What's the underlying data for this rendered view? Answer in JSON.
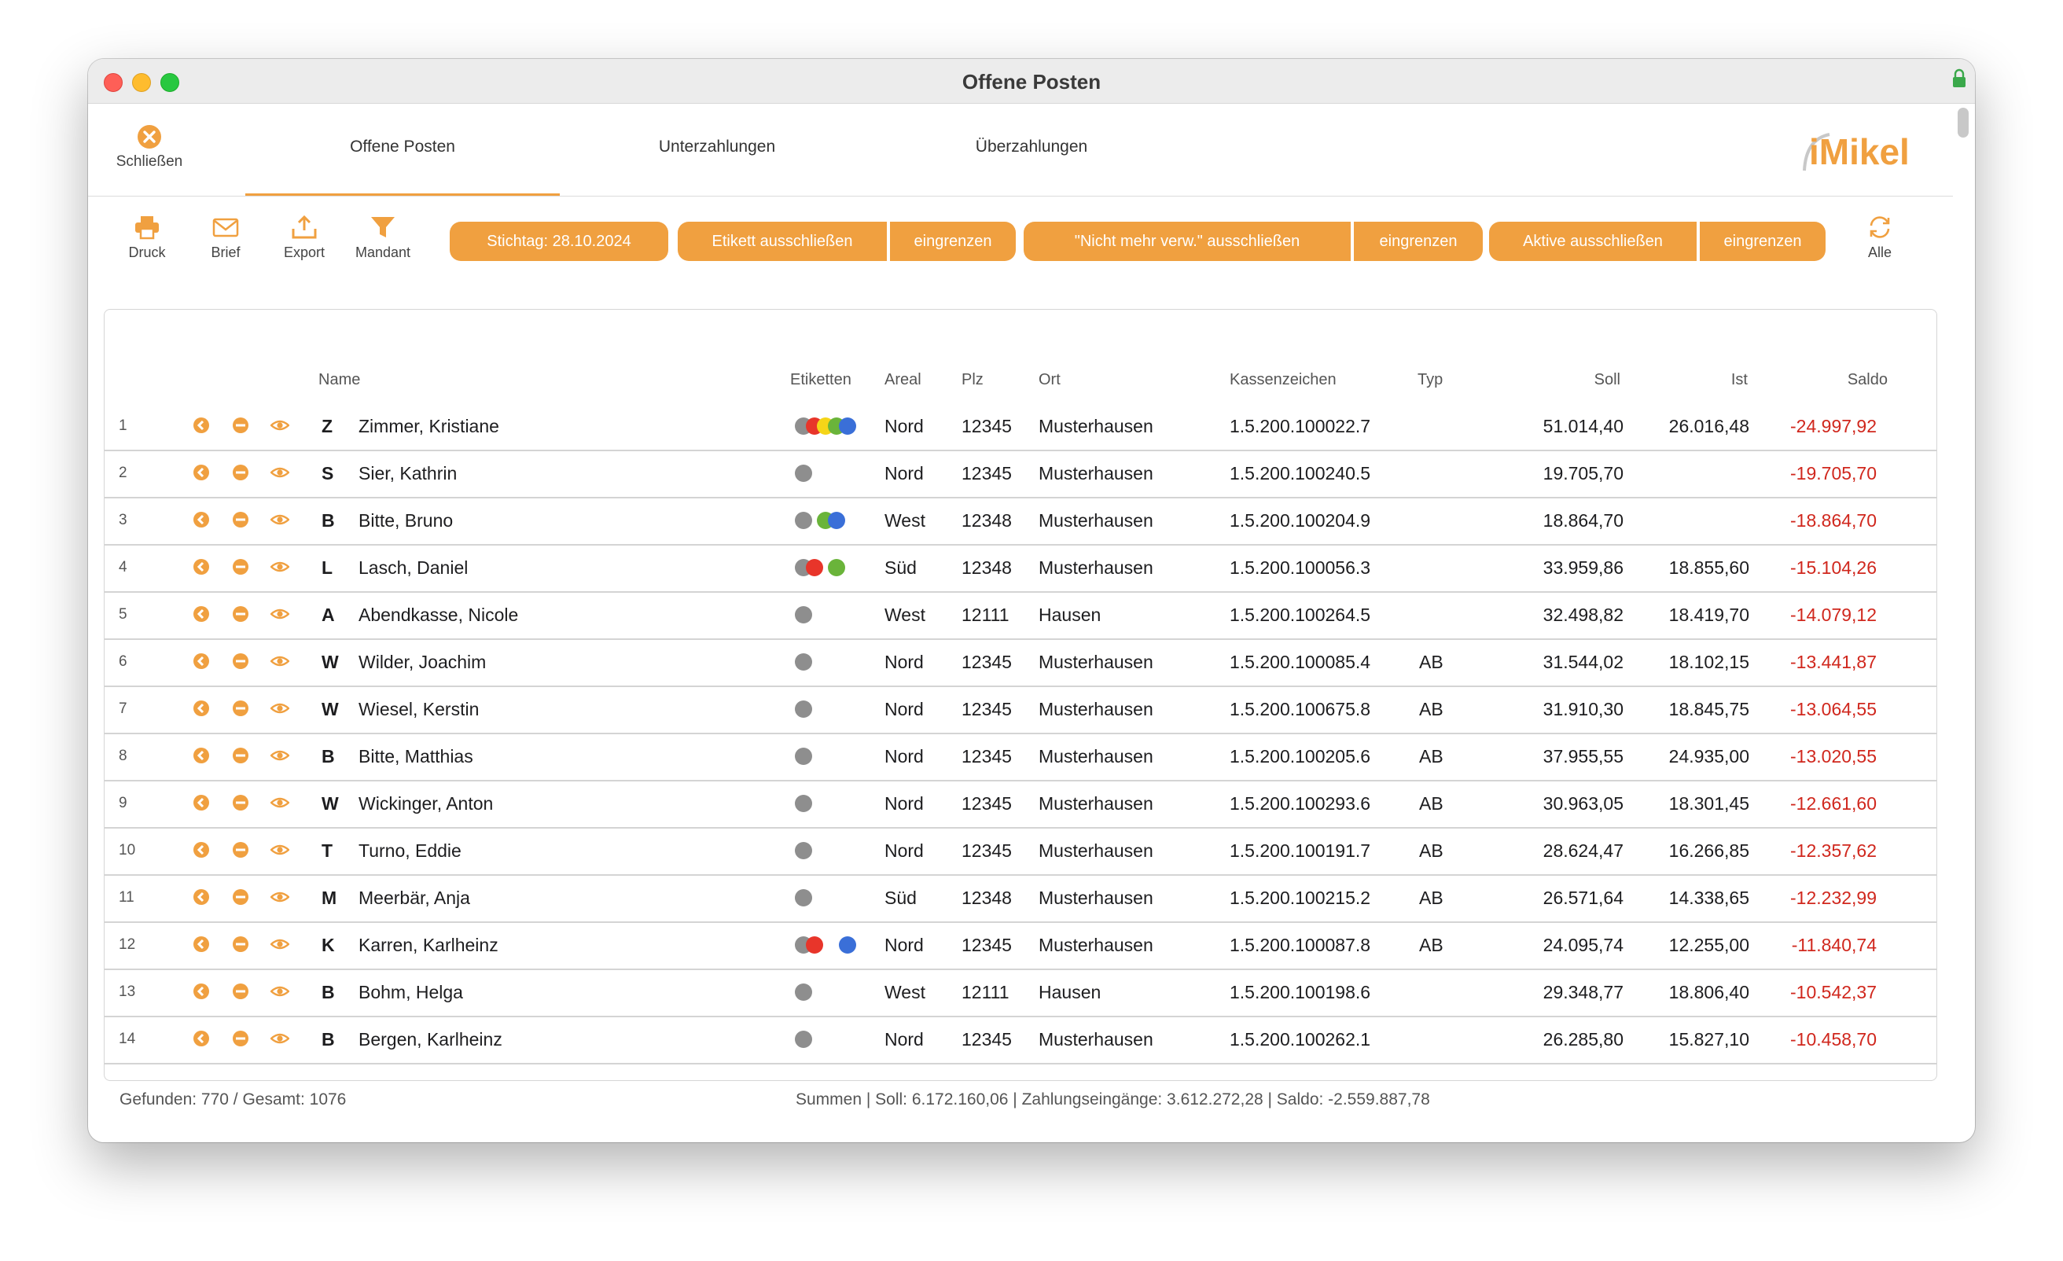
{
  "window": {
    "title": "Offene Posten"
  },
  "nav": {
    "close_label": "Schließen",
    "tabs": [
      {
        "label": "Offene Posten",
        "active": true
      },
      {
        "label": "Unterzahlungen",
        "active": false
      },
      {
        "label": "Überzahlungen",
        "active": false
      }
    ],
    "logo": "iMikel"
  },
  "toolbar": {
    "tools": [
      {
        "label": "Druck",
        "icon": "printer-icon"
      },
      {
        "label": "Brief",
        "icon": "envelope-icon"
      },
      {
        "label": "Export",
        "icon": "export-icon"
      },
      {
        "label": "Mandant",
        "icon": "filter-icon"
      }
    ],
    "stichtag": "Stichtag: 28.10.2024",
    "etikett_ausschliessen": "Etikett ausschließen",
    "etikett_eingrenzen": "eingrenzen",
    "nmv_ausschliessen": "\"Nicht mehr verw.\" ausschließen",
    "nmv_eingrenzen": "eingrenzen",
    "aktive_ausschliessen": "Aktive ausschließen",
    "aktive_eingrenzen": "eingrenzen",
    "alle_label": "Alle",
    "accent": "#f0a040"
  },
  "table": {
    "headers": {
      "name": "Name",
      "etiketten": "Etiketten",
      "areal": "Areal",
      "plz": "Plz",
      "ort": "Ort",
      "kassenzeichen": "Kassenzeichen",
      "typ": "Typ",
      "soll": "Soll",
      "ist": "Ist",
      "saldo": "Saldo"
    },
    "rows": [
      {
        "nr": "1",
        "letter": "Z",
        "name": "Zimmer, Kristiane",
        "tags": [
          "gray",
          "red",
          "yellow",
          "green",
          "blue"
        ],
        "areal": "Nord",
        "plz": "12345",
        "ort": "Musterhausen",
        "kz": "1.5.200.100022.7",
        "typ": "",
        "soll": "51.014,40",
        "ist": "26.016,48",
        "saldo": "-24.997,92"
      },
      {
        "nr": "2",
        "letter": "S",
        "name": "Sier, Kathrin",
        "tags": [
          "gray"
        ],
        "areal": "Nord",
        "plz": "12345",
        "ort": "Musterhausen",
        "kz": "1.5.200.100240.5",
        "typ": "",
        "soll": "19.705,70",
        "ist": "",
        "saldo": "-19.705,70"
      },
      {
        "nr": "3",
        "letter": "B",
        "name": "Bitte, Bruno",
        "tags": [
          "gray",
          "",
          "green",
          "blue"
        ],
        "areal": "West",
        "plz": "12348",
        "ort": "Musterhausen",
        "kz": "1.5.200.100204.9",
        "typ": "",
        "soll": "18.864,70",
        "ist": "",
        "saldo": "-18.864,70"
      },
      {
        "nr": "4",
        "letter": "L",
        "name": "Lasch, Daniel",
        "tags": [
          "gray",
          "red",
          "",
          "green"
        ],
        "areal": "Süd",
        "plz": "12348",
        "ort": "Musterhausen",
        "kz": "1.5.200.100056.3",
        "typ": "",
        "soll": "33.959,86",
        "ist": "18.855,60",
        "saldo": "-15.104,26"
      },
      {
        "nr": "5",
        "letter": "A",
        "name": "Abendkasse, Nicole",
        "tags": [
          "gray"
        ],
        "areal": "West",
        "plz": "12111",
        "ort": "Hausen",
        "kz": "1.5.200.100264.5",
        "typ": "",
        "soll": "32.498,82",
        "ist": "18.419,70",
        "saldo": "-14.079,12"
      },
      {
        "nr": "6",
        "letter": "W",
        "name": "Wilder, Joachim",
        "tags": [
          "gray"
        ],
        "areal": "Nord",
        "plz": "12345",
        "ort": "Musterhausen",
        "kz": "1.5.200.100085.4",
        "typ": "AB",
        "soll": "31.544,02",
        "ist": "18.102,15",
        "saldo": "-13.441,87"
      },
      {
        "nr": "7",
        "letter": "W",
        "name": "Wiesel, Kerstin",
        "tags": [
          "gray"
        ],
        "areal": "Nord",
        "plz": "12345",
        "ort": "Musterhausen",
        "kz": "1.5.200.100675.8",
        "typ": "AB",
        "soll": "31.910,30",
        "ist": "18.845,75",
        "saldo": "-13.064,55"
      },
      {
        "nr": "8",
        "letter": "B",
        "name": "Bitte, Matthias",
        "tags": [
          "gray"
        ],
        "areal": "Nord",
        "plz": "12345",
        "ort": "Musterhausen",
        "kz": "1.5.200.100205.6",
        "typ": "AB",
        "soll": "37.955,55",
        "ist": "24.935,00",
        "saldo": "-13.020,55"
      },
      {
        "nr": "9",
        "letter": "W",
        "name": "Wickinger, Anton",
        "tags": [
          "gray"
        ],
        "areal": "Nord",
        "plz": "12345",
        "ort": "Musterhausen",
        "kz": "1.5.200.100293.6",
        "typ": "AB",
        "soll": "30.963,05",
        "ist": "18.301,45",
        "saldo": "-12.661,60"
      },
      {
        "nr": "10",
        "letter": "T",
        "name": "Turno, Eddie",
        "tags": [
          "gray"
        ],
        "areal": "Nord",
        "plz": "12345",
        "ort": "Musterhausen",
        "kz": "1.5.200.100191.7",
        "typ": "AB",
        "soll": "28.624,47",
        "ist": "16.266,85",
        "saldo": "-12.357,62"
      },
      {
        "nr": "11",
        "letter": "M",
        "name": "Meerbär, Anja",
        "tags": [
          "gray"
        ],
        "areal": "Süd",
        "plz": "12348",
        "ort": "Musterhausen",
        "kz": "1.5.200.100215.2",
        "typ": "AB",
        "soll": "26.571,64",
        "ist": "14.338,65",
        "saldo": "-12.232,99"
      },
      {
        "nr": "12",
        "letter": "K",
        "name": "Karren, Karlheinz",
        "tags": [
          "gray",
          "red",
          "",
          "",
          "blue"
        ],
        "areal": "Nord",
        "plz": "12345",
        "ort": "Musterhausen",
        "kz": "1.5.200.100087.8",
        "typ": "AB",
        "soll": "24.095,74",
        "ist": "12.255,00",
        "saldo": "-11.840,74"
      },
      {
        "nr": "13",
        "letter": "B",
        "name": "Bohm, Helga",
        "tags": [
          "gray"
        ],
        "areal": "West",
        "plz": "12111",
        "ort": "Hausen",
        "kz": "1.5.200.100198.6",
        "typ": "",
        "soll": "29.348,77",
        "ist": "18.806,40",
        "saldo": "-10.542,37"
      },
      {
        "nr": "14",
        "letter": "B",
        "name": "Bergen, Karlheinz",
        "tags": [
          "gray"
        ],
        "areal": "Nord",
        "plz": "12345",
        "ort": "Musterhausen",
        "kz": "1.5.200.100262.1",
        "typ": "",
        "soll": "26.285,80",
        "ist": "15.827,10",
        "saldo": "-10.458,70"
      }
    ]
  },
  "footer": {
    "found": "Gefunden: 770 / Gesamt: 1076",
    "sums": "Summen  |  Soll: 6.172.160,06  |  Zahlungseingänge: 3.612.272,28  |  Saldo: -2.559.887,78"
  },
  "colors": {
    "gray": "#8e8e8e",
    "red": "#e8352a",
    "yellow": "#f5d518",
    "green": "#6ab43a",
    "blue": "#3a6fd8",
    "negative": "#d0271d"
  }
}
